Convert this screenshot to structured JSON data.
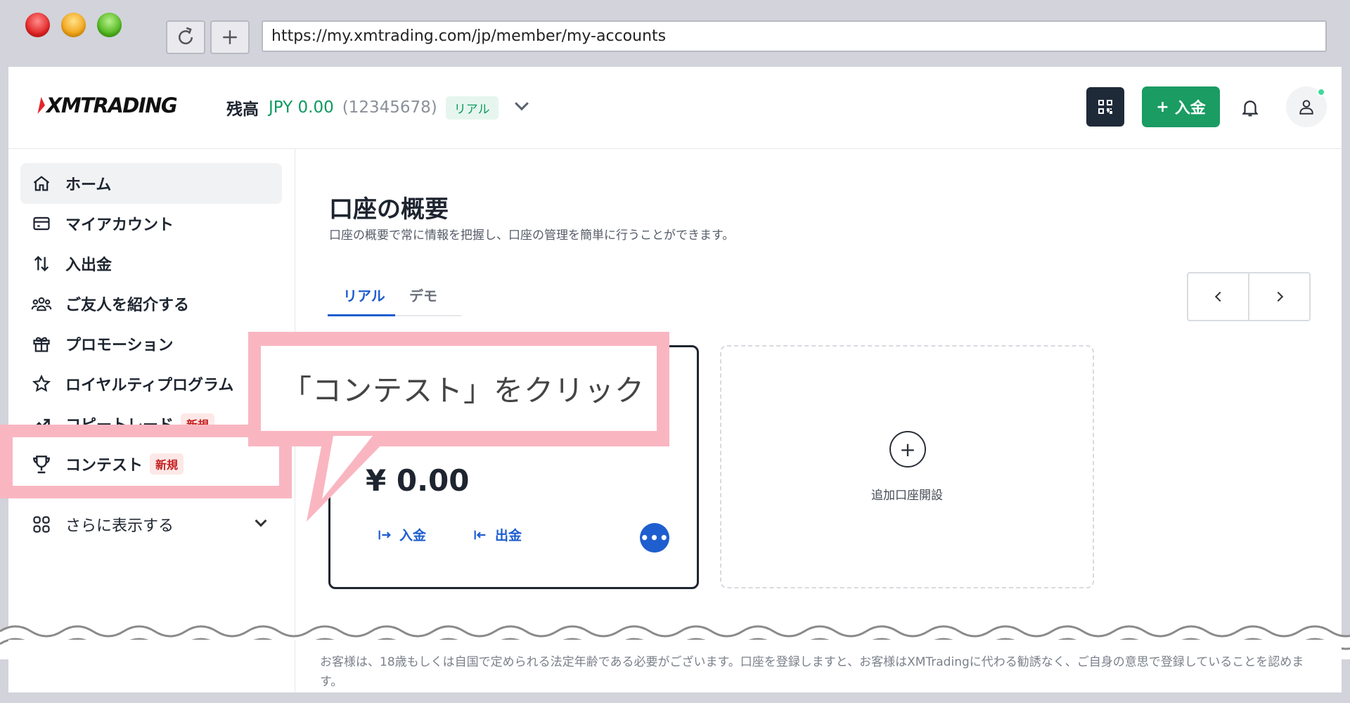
{
  "browser": {
    "url": "https://my.xmtrading.com/jp/member/my-accounts",
    "reload_icon": "reload-icon",
    "newtab_icon": "plus-icon"
  },
  "header": {
    "logo": "XMTRADING",
    "balance_label": "残高",
    "balance_amount": "JPY 0.00",
    "account_number": "(12345678)",
    "account_type_badge": "リアル",
    "deposit_button": "入金",
    "deposit_prefix": "+",
    "brand_color": "#1a9c63"
  },
  "sidebar": {
    "items": [
      {
        "label": "ホーム",
        "icon": "home-icon"
      },
      {
        "label": "マイアカウント",
        "icon": "card-icon"
      },
      {
        "label": "入出金",
        "icon": "transfer-arrows-icon"
      },
      {
        "label": "ご友人を紹介する",
        "icon": "users-icon"
      },
      {
        "label": "プロモーション",
        "icon": "gift-icon"
      },
      {
        "label": "ロイヤルティプログラム",
        "icon": "star-icon"
      },
      {
        "label": "コピートレード",
        "icon": "trend-icon",
        "badge": "新規"
      },
      {
        "label": "コンテスト",
        "icon": "trophy-icon",
        "badge": "新規"
      },
      {
        "label": "さらに表示する",
        "icon": "grid-icon"
      }
    ]
  },
  "main": {
    "title": "口座の概要",
    "subtitle": "口座の概要で常に情報を把握し、口座の管理を簡単に行うことができます。",
    "tabs": [
      {
        "label": "リアル",
        "active": true
      },
      {
        "label": "デモ",
        "active": false
      }
    ],
    "account_card": {
      "amount": "¥ 0.00",
      "deposit_label": "入金",
      "withdraw_label": "出金",
      "more_label": "•••"
    },
    "add_account": {
      "plus": "+",
      "label": "追加口座開設"
    }
  },
  "callout": {
    "text": "「コンテスト」をクリック",
    "color": "#f9b6c1"
  },
  "footer": {
    "notice": "お客様は、18歳もしくは自国で定められる法定年齢である必要がございます。口座を登録しますと、お客様はXMTradingに代わる勧誘なく、ご自身の意思で登録していることを認めます。"
  }
}
